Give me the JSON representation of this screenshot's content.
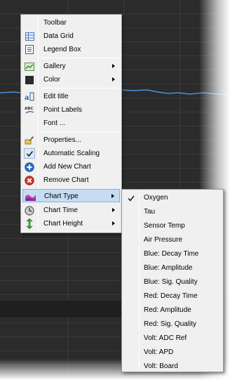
{
  "main_menu": {
    "items": [
      {
        "label": "Toolbar",
        "icon": "none"
      },
      {
        "label": "Data Grid",
        "icon": "data-grid-icon"
      },
      {
        "label": "Legend Box",
        "icon": "legend-box-icon"
      },
      {
        "label": "Gallery",
        "icon": "gallery-icon",
        "has_submenu": true
      },
      {
        "label": "Color",
        "icon": "color-swatch-icon",
        "has_submenu": true
      },
      {
        "label": "Edit title",
        "icon": "edit-title-icon"
      },
      {
        "label": "Point Labels",
        "icon": "point-labels-icon"
      },
      {
        "label": "Font ...",
        "icon": "none"
      },
      {
        "label": "Properties...",
        "icon": "properties-icon"
      },
      {
        "label": "Automatic Scaling",
        "icon": "check-icon",
        "checked": true
      },
      {
        "label": "Add New Chart",
        "icon": "add-icon"
      },
      {
        "label": "Remove Chart",
        "icon": "remove-icon"
      },
      {
        "label": "Chart Type",
        "icon": "chart-type-icon",
        "has_submenu": true,
        "highlighted": true
      },
      {
        "label": "Chart Time",
        "icon": "clock-icon",
        "has_submenu": true
      },
      {
        "label": "Chart Height",
        "icon": "height-icon",
        "has_submenu": true
      }
    ]
  },
  "chart_type_submenu": {
    "items": [
      {
        "label": "Oxygen",
        "checked": true
      },
      {
        "label": "Tau"
      },
      {
        "label": "Sensor Temp"
      },
      {
        "label": "Air Pressure"
      },
      {
        "label": "Blue: Decay Time"
      },
      {
        "label": "Blue: Amplitude"
      },
      {
        "label": "Blue: Sig. Quality"
      },
      {
        "label": "Red: Decay Time"
      },
      {
        "label": "Red: Amplitude"
      },
      {
        "label": "Red: Sig. Quality"
      },
      {
        "label": "Volt: ADC Ref"
      },
      {
        "label": "Volt: APD"
      },
      {
        "label": "Volt: Board"
      }
    ]
  },
  "colors": {
    "menu_bg": "#f0f0f0",
    "highlight_bg": "#c5dcf2",
    "highlight_border": "#7eb4ea",
    "chart_bg": "#2b2b2b",
    "trace": "#4a90d9"
  }
}
